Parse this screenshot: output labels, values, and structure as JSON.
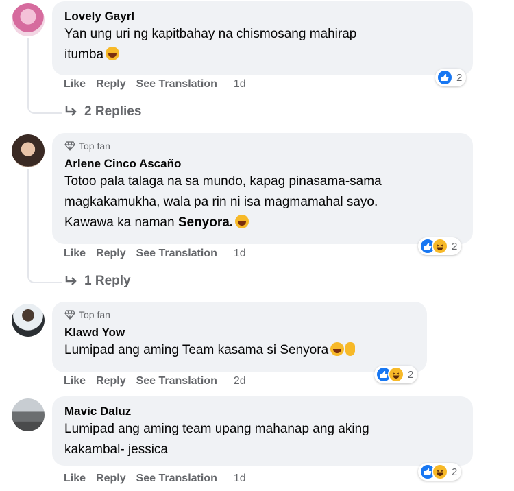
{
  "actions": {
    "like": "Like",
    "reply": "Reply",
    "translate": "See Translation"
  },
  "comments": [
    {
      "name": "Lovely Gayrl",
      "badge": "",
      "text_line1": "Yan ung uri ng kapitbahay na chismosang mahirap",
      "text_line2": "itumba",
      "time": "1d",
      "reaction_count": "2",
      "replies": "2 Replies"
    },
    {
      "name": "Arlene Cinco Ascaño",
      "badge": "Top fan",
      "text_line1": "Totoo pala talaga na sa mundo, kapag pinasama-sama",
      "text_line2": "magkakamukha, wala pa rin ni isa magmamahal sayo.",
      "text_line3_a": "Kawawa ka naman ",
      "text_line3_b": "Senyora.",
      "time": "1d",
      "reaction_count": "2",
      "replies": "1 Reply"
    },
    {
      "name": "Klawd Yow",
      "badge": "Top fan",
      "text_line1": "Lumipad ang aming Team kasama si Senyora",
      "time": "2d",
      "reaction_count": "2"
    },
    {
      "name": "Mavic Daluz",
      "badge": "",
      "text_line1": "Lumipad ang aming team upang mahanap ang aking",
      "text_line2": "kakambal- jessica",
      "time": "1d",
      "reaction_count": "2"
    }
  ],
  "colors": {
    "like_blue": "#1877f2",
    "haha_yellow": "#f7b928",
    "bubble": "#f0f2f5",
    "meta_gray": "#65676b"
  }
}
